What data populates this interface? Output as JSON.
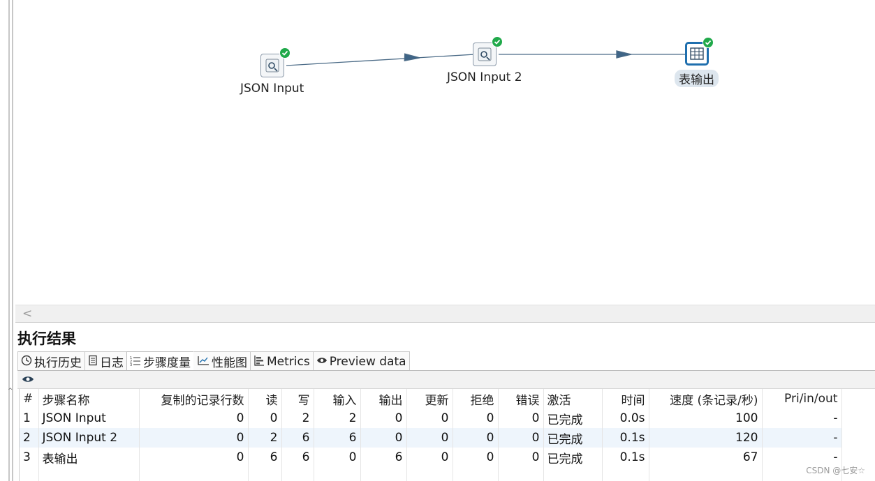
{
  "canvas": {
    "steps": [
      {
        "label": "JSON Input",
        "status": "success"
      },
      {
        "label": "JSON Input 2",
        "status": "success"
      },
      {
        "label": "表输出",
        "status": "success"
      }
    ]
  },
  "results": {
    "title": "执行结果",
    "tabs": [
      {
        "label": "执行历史",
        "icon": "clock-icon"
      },
      {
        "label": "日志",
        "icon": "log-icon"
      },
      {
        "label": "步骤度量",
        "icon": "list-icon",
        "active": true
      },
      {
        "label": "性能图",
        "icon": "chart-icon"
      },
      {
        "label": "Metrics",
        "icon": "metrics-icon"
      },
      {
        "label": "Preview data",
        "icon": "eye-icon"
      }
    ],
    "columns": [
      "#",
      "步骤名称",
      "复制的记录行数",
      "读",
      "写",
      "输入",
      "输出",
      "更新",
      "拒绝",
      "错误",
      "激活",
      "时间",
      "速度 (条记录/秒)",
      "Pri/in/out"
    ],
    "rows": [
      [
        "1",
        "JSON Input",
        "0",
        "0",
        "2",
        "2",
        "0",
        "0",
        "0",
        "0",
        "已完成",
        "0.0s",
        "100",
        "-"
      ],
      [
        "2",
        "JSON Input 2",
        "0",
        "2",
        "6",
        "6",
        "0",
        "0",
        "0",
        "0",
        "已完成",
        "0.1s",
        "120",
        "-"
      ],
      [
        "3",
        "表输出",
        "0",
        "6",
        "6",
        "0",
        "6",
        "0",
        "0",
        "0",
        "已完成",
        "0.1s",
        "67",
        "-"
      ]
    ]
  },
  "scroll": {
    "left_arrow": "<"
  },
  "watermark": "CSDN @七安☆",
  "colors": {
    "accent": "#1f6fae",
    "success": "#20a94a",
    "row_alt": "#eef5fc"
  }
}
